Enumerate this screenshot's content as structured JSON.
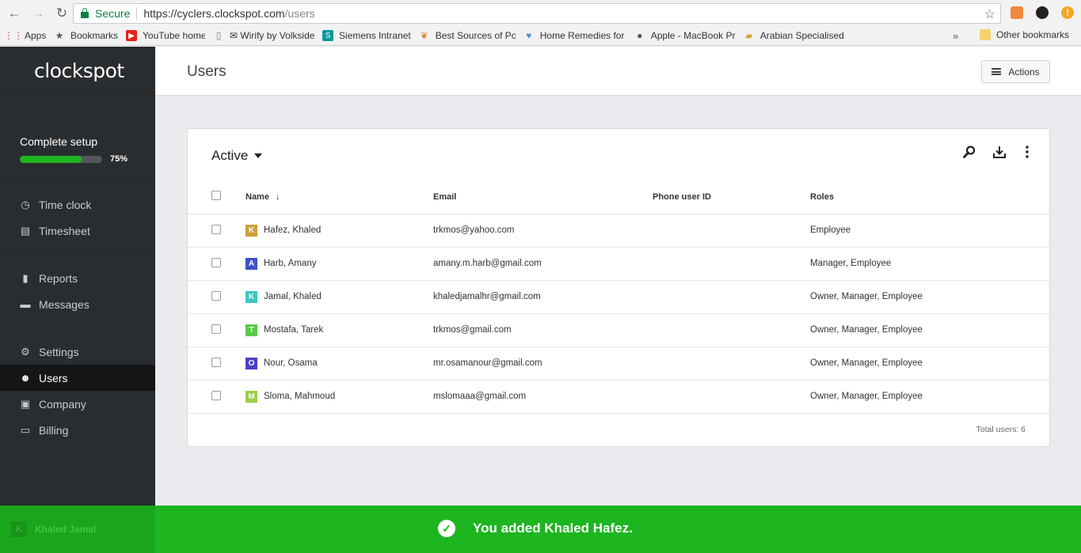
{
  "browser": {
    "secure_label": "Secure",
    "url_host": "https://cyclers.clockspot.com",
    "url_path": "/users",
    "bookmarks": [
      {
        "label": "Apps",
        "icon": "apps-grid-icon",
        "color": "#e94235"
      },
      {
        "label": "Bookmarks",
        "icon": "star-icon",
        "color": "#555555"
      },
      {
        "label": "YouTube home",
        "icon": "youtube-icon",
        "color": "#e62117"
      },
      {
        "label": "✉ Wirify by Volkside",
        "icon": "page-icon",
        "color": "#777777"
      },
      {
        "label": "Siemens Intranet",
        "icon": "siemens-icon",
        "color": "#009999"
      },
      {
        "label": "Best Sources of Potas",
        "icon": "leaf-icon",
        "color": "#d9822b"
      },
      {
        "label": "Home Remedies for D",
        "icon": "heart-icon",
        "color": "#4a90d9"
      },
      {
        "label": "Apple - MacBook Pro",
        "icon": "apple-icon",
        "color": "#555555"
      },
      {
        "label": "Arabian Specialised M",
        "icon": "book-icon",
        "color": "#e0a030"
      }
    ],
    "more_label": "»",
    "other_bookmarks": "Other bookmarks"
  },
  "sidebar": {
    "logo": "clockspot",
    "setup_title": "Complete setup",
    "setup_percent_label": "75%",
    "setup_progress": 0.75,
    "groups": [
      [
        {
          "label": "Time clock",
          "icon": "clock-icon",
          "name": "sidebar-item-time-clock"
        },
        {
          "label": "Timesheet",
          "icon": "clipboard-icon",
          "name": "sidebar-item-timesheet"
        }
      ],
      [
        {
          "label": "Reports",
          "icon": "bar-chart-icon",
          "name": "sidebar-item-reports"
        },
        {
          "label": "Messages",
          "icon": "message-icon",
          "name": "sidebar-item-messages"
        }
      ],
      [
        {
          "label": "Settings",
          "icon": "gears-icon",
          "name": "sidebar-item-settings"
        },
        {
          "label": "Users",
          "icon": "users-icon",
          "name": "sidebar-item-users",
          "active": true
        },
        {
          "label": "Company",
          "icon": "briefcase-icon",
          "name": "sidebar-item-company"
        },
        {
          "label": "Billing",
          "icon": "card-icon",
          "name": "sidebar-item-billing"
        }
      ]
    ]
  },
  "header": {
    "title": "Users",
    "actions_label": "Actions"
  },
  "users_table": {
    "filter_label": "Active",
    "columns": {
      "name": "Name",
      "email": "Email",
      "phone": "Phone user ID",
      "roles": "Roles"
    },
    "sort_indicator": "↓",
    "rows": [
      {
        "initial": "K",
        "avatar_color": "#c9a03c",
        "name": "Hafez, Khaled",
        "email": "trkmos@yahoo.com",
        "phone": "",
        "roles": "Employee"
      },
      {
        "initial": "A",
        "avatar_color": "#3f51c4",
        "name": "Harb, Amany",
        "email": "amany.m.harb@gmail.com",
        "phone": "",
        "roles": "Manager, Employee"
      },
      {
        "initial": "K",
        "avatar_color": "#3fc6c0",
        "name": "Jamal, Khaled",
        "email": "khaledjamalhr@gmail.com",
        "phone": "",
        "roles": "Owner, Manager, Employee"
      },
      {
        "initial": "T",
        "avatar_color": "#5ac94a",
        "name": "Mostafa, Tarek",
        "email": "trkmos@gmail.com",
        "phone": "",
        "roles": "Owner, Manager, Employee"
      },
      {
        "initial": "O",
        "avatar_color": "#4a3fc4",
        "name": "Nour, Osama",
        "email": "mr.osamanour@gmail.com",
        "phone": "",
        "roles": "Owner, Manager, Employee"
      },
      {
        "initial": "M",
        "avatar_color": "#9acd4a",
        "name": "Sloma, Mahmoud",
        "email": "mslomaaa@gmail.com",
        "phone": "",
        "roles": "Owner, Manager, Employee"
      }
    ],
    "total_label": "Total users: 6"
  },
  "toast": {
    "message": "You added Khaled Hafez.",
    "user_initial": "K",
    "user_name": "Khaled Jamal"
  },
  "colors": {
    "accent_green": "#1db520",
    "sidebar_bg": "#2a2d30"
  }
}
